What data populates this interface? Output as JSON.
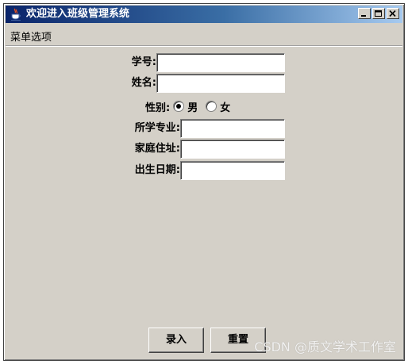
{
  "window": {
    "title": "欢迎进入班级管理系统",
    "minimize_glyph": "_",
    "maximize_glyph": "□",
    "close_glyph": "×"
  },
  "menubar": {
    "items": [
      "菜单选项"
    ]
  },
  "form": {
    "student_id": {
      "label": "学号:",
      "value": ""
    },
    "name": {
      "label": "姓名:",
      "value": ""
    },
    "gender": {
      "label": "性别:",
      "options": [
        "男",
        "女"
      ],
      "selected": "男"
    },
    "major": {
      "label": "所学专业:",
      "value": ""
    },
    "address": {
      "label": "家庭住址:",
      "value": ""
    },
    "birthdate": {
      "label": "出生日期:",
      "value": ""
    }
  },
  "buttons": {
    "submit_label": "录入",
    "reset_label": "重置"
  },
  "watermark": "CSDN @质文学术工作室",
  "colors": {
    "window_bg": "#d4d0c8",
    "titlebar_start": "#0a246a",
    "titlebar_end": "#a6caf0"
  }
}
